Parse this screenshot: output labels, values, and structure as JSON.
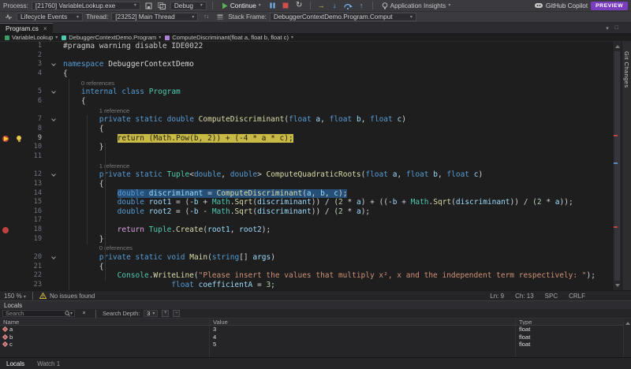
{
  "toolbar": {
    "process_label": "Process:",
    "process_value": "[21760] VariableLookup.exe",
    "config_value": "Debug",
    "continue_label": "Continue",
    "app_insights_label": "Application Insights",
    "copilot_label": "GitHub Copilot",
    "preview_label": "PREVIEW"
  },
  "location_bar": {
    "lifecycle_label": "Lifecycle Events",
    "thread_label": "Thread:",
    "thread_value": "[23252] Main Thread",
    "stack_label": "Stack Frame:",
    "stack_value": "DebuggerContextDemo.Program.Comput"
  },
  "tab_bar": {
    "active_tab": "Program.cs"
  },
  "breadcrumb": {
    "project": "VariableLookup",
    "type": "DebuggerContextDemo.Program",
    "member": "ComputeDiscriminant(float a, float b, float c)"
  },
  "editor": {
    "rows": [
      {
        "n": "1",
        "ind": 0,
        "tok": [
          [
            "pp",
            "#pragma warning disable IDE0022"
          ]
        ]
      },
      {
        "n": "2",
        "ind": 0,
        "tok": []
      },
      {
        "n": "3",
        "ind": 0,
        "fold": true,
        "tok": [
          [
            "kw",
            "namespace"
          ],
          [
            "pun",
            " "
          ],
          [
            "ns",
            "DebuggerContextDemo"
          ]
        ]
      },
      {
        "n": "4",
        "ind": 0,
        "tok": [
          [
            "pun",
            "{"
          ]
        ]
      },
      {
        "lens": "0 references",
        "ind": 4
      },
      {
        "n": "5",
        "ind": 4,
        "fold": true,
        "tok": [
          [
            "kw",
            "internal"
          ],
          [
            "pun",
            " "
          ],
          [
            "kw",
            "class"
          ],
          [
            "pun",
            " "
          ],
          [
            "type",
            "Program"
          ]
        ]
      },
      {
        "n": "6",
        "ind": 4,
        "tok": [
          [
            "pun",
            "{"
          ]
        ]
      },
      {
        "lens": "1 reference",
        "ind": 8
      },
      {
        "n": "7",
        "ind": 8,
        "fold": true,
        "tok": [
          [
            "kw",
            "private"
          ],
          [
            "pun",
            " "
          ],
          [
            "kw",
            "static"
          ],
          [
            "pun",
            " "
          ],
          [
            "kw",
            "double"
          ],
          [
            "pun",
            " "
          ],
          [
            "method",
            "ComputeDiscriminant"
          ],
          [
            "pun",
            "("
          ],
          [
            "kw",
            "float"
          ],
          [
            "pun",
            " "
          ],
          [
            "param",
            "a"
          ],
          [
            "pun",
            ", "
          ],
          [
            "kw",
            "float"
          ],
          [
            "pun",
            " "
          ],
          [
            "param",
            "b"
          ],
          [
            "pun",
            ", "
          ],
          [
            "kw",
            "float"
          ],
          [
            "pun",
            " "
          ],
          [
            "param",
            "c"
          ],
          [
            "pun",
            ")"
          ]
        ]
      },
      {
        "n": "8",
        "ind": 8,
        "tok": [
          [
            "pun",
            "{"
          ]
        ]
      },
      {
        "n": "9",
        "ind": 12,
        "bp": true,
        "cur": true,
        "bulb": true,
        "tok": [
          [
            "cur",
            "return (Math.Pow(b, 2)) + (-4 * a * c);"
          ]
        ]
      },
      {
        "n": "10",
        "ind": 8,
        "tok": [
          [
            "pun",
            "}"
          ]
        ]
      },
      {
        "n": "11",
        "ind": 0,
        "tok": []
      },
      {
        "lens": "1 reference",
        "ind": 8
      },
      {
        "n": "12",
        "ind": 8,
        "fold": true,
        "tok": [
          [
            "kw",
            "private"
          ],
          [
            "pun",
            " "
          ],
          [
            "kw",
            "static"
          ],
          [
            "pun",
            " "
          ],
          [
            "type",
            "Tuple"
          ],
          [
            "pun",
            "<"
          ],
          [
            "kw",
            "double"
          ],
          [
            "pun",
            ", "
          ],
          [
            "kw",
            "double"
          ],
          [
            "pun",
            "> "
          ],
          [
            "method",
            "ComputeQuadraticRoots"
          ],
          [
            "pun",
            "("
          ],
          [
            "kw",
            "float"
          ],
          [
            "pun",
            " "
          ],
          [
            "param",
            "a"
          ],
          [
            "pun",
            ", "
          ],
          [
            "kw",
            "float"
          ],
          [
            "pun",
            " "
          ],
          [
            "param",
            "b"
          ],
          [
            "pun",
            ", "
          ],
          [
            "kw",
            "float"
          ],
          [
            "pun",
            " "
          ],
          [
            "param",
            "c"
          ],
          [
            "pun",
            ")"
          ]
        ]
      },
      {
        "n": "13",
        "ind": 8,
        "tok": [
          [
            "pun",
            "{"
          ]
        ]
      },
      {
        "n": "14",
        "ind": 12,
        "sel": true,
        "tok": [
          [
            "kw",
            "double"
          ],
          [
            "pun",
            " "
          ],
          [
            "param",
            "discriminant"
          ],
          [
            "pun",
            " = "
          ],
          [
            "method",
            "ComputeDiscriminant"
          ],
          [
            "pun",
            "("
          ],
          [
            "param",
            "a"
          ],
          [
            "pun",
            ", "
          ],
          [
            "param",
            "b"
          ],
          [
            "pun",
            ", "
          ],
          [
            "param",
            "c"
          ],
          [
            "pun",
            ");"
          ]
        ]
      },
      {
        "n": "15",
        "ind": 12,
        "tok": [
          [
            "kw",
            "double"
          ],
          [
            "pun",
            " "
          ],
          [
            "param",
            "root1"
          ],
          [
            "pun",
            " = (-"
          ],
          [
            "param",
            "b"
          ],
          [
            "pun",
            " + "
          ],
          [
            "type",
            "Math"
          ],
          [
            "pun",
            "."
          ],
          [
            "method",
            "Sqrt"
          ],
          [
            "pun",
            "("
          ],
          [
            "param",
            "discriminant"
          ],
          [
            "pun",
            ")) / ("
          ],
          [
            "num",
            "2"
          ],
          [
            "pun",
            " * "
          ],
          [
            "param",
            "a"
          ],
          [
            "pun",
            ") + ((-"
          ],
          [
            "param",
            "b"
          ],
          [
            "pun",
            " + "
          ],
          [
            "type",
            "Math"
          ],
          [
            "pun",
            "."
          ],
          [
            "method",
            "Sqrt"
          ],
          [
            "pun",
            "("
          ],
          [
            "param",
            "discriminant"
          ],
          [
            "pun",
            ")) / ("
          ],
          [
            "num",
            "2"
          ],
          [
            "pun",
            " * "
          ],
          [
            "param",
            "a"
          ],
          [
            "pun",
            "));"
          ]
        ]
      },
      {
        "n": "16",
        "ind": 12,
        "tok": [
          [
            "kw",
            "double"
          ],
          [
            "pun",
            " "
          ],
          [
            "param",
            "root2"
          ],
          [
            "pun",
            " = (-"
          ],
          [
            "param",
            "b"
          ],
          [
            "pun",
            " - "
          ],
          [
            "type",
            "Math"
          ],
          [
            "pun",
            "."
          ],
          [
            "method",
            "Sqrt"
          ],
          [
            "pun",
            "("
          ],
          [
            "param",
            "discriminant"
          ],
          [
            "pun",
            ")) / ("
          ],
          [
            "num",
            "2"
          ],
          [
            "pun",
            " * "
          ],
          [
            "param",
            "a"
          ],
          [
            "pun",
            ");"
          ]
        ]
      },
      {
        "n": "17",
        "ind": 0,
        "tok": []
      },
      {
        "n": "18",
        "ind": 12,
        "bp": true,
        "tok": [
          [
            "ctrl",
            "return"
          ],
          [
            "pun",
            " "
          ],
          [
            "type",
            "Tuple"
          ],
          [
            "pun",
            "."
          ],
          [
            "method",
            "Create"
          ],
          [
            "pun",
            "("
          ],
          [
            "param",
            "root1"
          ],
          [
            "pun",
            ", "
          ],
          [
            "param",
            "root2"
          ],
          [
            "pun",
            ");"
          ]
        ]
      },
      {
        "n": "19",
        "ind": 8,
        "tok": [
          [
            "pun",
            "}"
          ]
        ]
      },
      {
        "lens": "0 references",
        "ind": 8
      },
      {
        "n": "20",
        "ind": 8,
        "fold": true,
        "tok": [
          [
            "kw",
            "private"
          ],
          [
            "pun",
            " "
          ],
          [
            "kw",
            "static"
          ],
          [
            "pun",
            " "
          ],
          [
            "kw",
            "void"
          ],
          [
            "pun",
            " "
          ],
          [
            "method",
            "Main"
          ],
          [
            "pun",
            "("
          ],
          [
            "kw",
            "string"
          ],
          [
            "pun",
            "[] "
          ],
          [
            "param",
            "args"
          ],
          [
            "pun",
            ")"
          ]
        ]
      },
      {
        "n": "21",
        "ind": 8,
        "tok": [
          [
            "pun",
            "{"
          ]
        ]
      },
      {
        "n": "22",
        "ind": 12,
        "tok": [
          [
            "type",
            "Console"
          ],
          [
            "pun",
            "."
          ],
          [
            "method",
            "WriteLine"
          ],
          [
            "pun",
            "("
          ],
          [
            "str",
            "\"Please insert the values that multiply x², x and the independent term respectively: \""
          ],
          [
            "pun",
            ");"
          ]
        ]
      },
      {
        "n": "23",
        "ind": 24,
        "tok": [
          [
            "kw",
            "float"
          ],
          [
            "pun",
            " "
          ],
          [
            "param",
            "coefficientA"
          ],
          [
            "pun",
            " = "
          ],
          [
            "num",
            "3"
          ],
          [
            "pun",
            ";"
          ]
        ]
      }
    ]
  },
  "status_bar": {
    "zoom": "150 %",
    "issues": "No issues found",
    "line": "Ln: 9",
    "column": "Ch: 13",
    "spaces": "SPC",
    "line_ending": "CRLF"
  },
  "locals_panel": {
    "title": "Locals",
    "search_placeholder": "Search",
    "depth_label": "Search Depth:",
    "depth_value": "3",
    "columns": [
      "Name",
      "Value",
      "Type"
    ],
    "rows": [
      {
        "name": "a",
        "value": "3",
        "type": "float"
      },
      {
        "name": "b",
        "value": "4",
        "type": "float"
      },
      {
        "name": "c",
        "value": "5",
        "type": "float"
      }
    ]
  },
  "panel_tabs": [
    "Locals",
    "Watch 1"
  ],
  "side_tab": "Git Changes"
}
